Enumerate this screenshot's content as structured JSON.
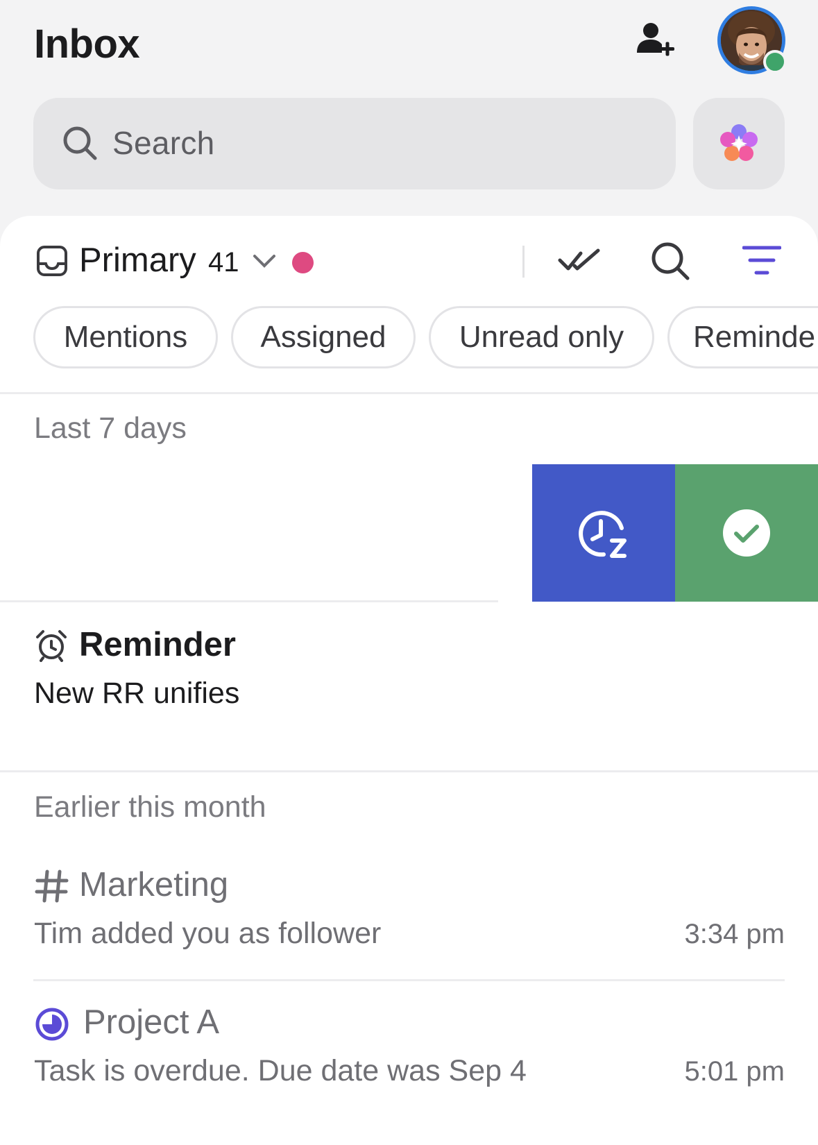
{
  "header": {
    "title": "Inbox"
  },
  "search": {
    "placeholder": "Search"
  },
  "inbox": {
    "label": "Primary",
    "count": "41"
  },
  "filters": [
    {
      "label": "Mentions"
    },
    {
      "label": "Assigned"
    },
    {
      "label": "Unread only"
    },
    {
      "label": "Reminde"
    }
  ],
  "sections": {
    "recent": "Last 7 days",
    "earlier": "Earlier this month"
  },
  "reminder": {
    "title": "Reminder",
    "body": "New RR unifies"
  },
  "notifications": [
    {
      "title": "Marketing",
      "body": "Tim added you as follower",
      "time": "3:34 pm",
      "icon": "hash-icon"
    },
    {
      "title": "Project A",
      "body": "Task is overdue. Due date was Sep 4",
      "time": "5:01 pm",
      "icon": "project-status-icon"
    }
  ],
  "colors": {
    "accent": "#5b4bd6",
    "unread_dot": "#de4a81",
    "snooze_action": "#4259c7",
    "done_action": "#5aa26e",
    "online_status": "#3fa46a"
  }
}
